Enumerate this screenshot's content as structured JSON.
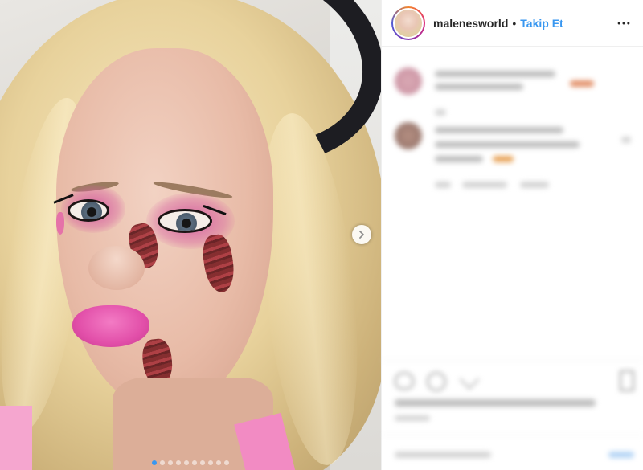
{
  "post": {
    "carousel": {
      "slide_count": 10,
      "active_index": 0
    }
  },
  "header": {
    "username": "malenesworld",
    "separator": "•",
    "follow_label": "Takip Et",
    "follow_color": "#3897f0"
  },
  "icons": {
    "next": "chevron-right-icon",
    "more": "more-horizontal-icon",
    "like": "heart-icon",
    "comment": "comment-icon",
    "share": "share-icon",
    "save": "bookmark-icon"
  },
  "colors": {
    "accent": "#3897f0",
    "text": "#262626",
    "border": "#efefef"
  }
}
